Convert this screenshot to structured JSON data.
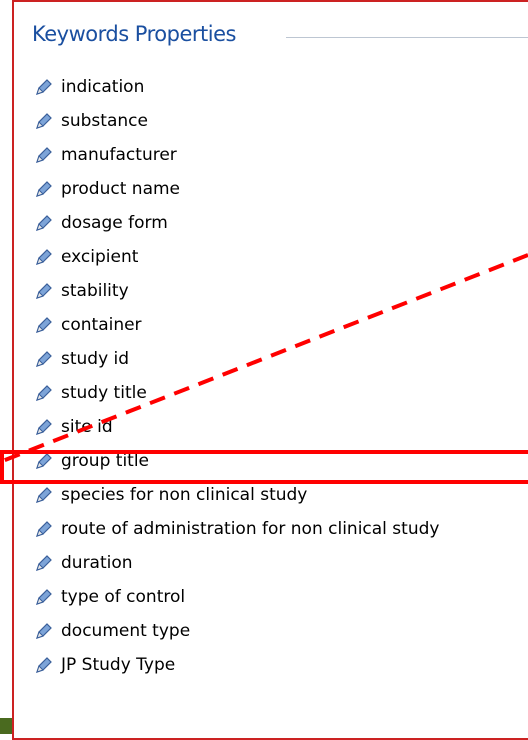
{
  "panel": {
    "title": "Keywords Properties",
    "items": [
      {
        "label": "indication"
      },
      {
        "label": "substance"
      },
      {
        "label": "manufacturer"
      },
      {
        "label": "product name"
      },
      {
        "label": "dosage form"
      },
      {
        "label": "excipient"
      },
      {
        "label": "stability"
      },
      {
        "label": "container"
      },
      {
        "label": "study id"
      },
      {
        "label": "study title"
      },
      {
        "label": "site id"
      },
      {
        "label": "group title"
      },
      {
        "label": "species for non clinical study"
      },
      {
        "label": "route of administration for non clinical study"
      },
      {
        "label": "duration"
      },
      {
        "label": "type of control"
      },
      {
        "label": "document type"
      },
      {
        "label": "JP Study Type"
      }
    ],
    "highlighted_item": "group title",
    "item_icon": "pencil-icon"
  },
  "colors": {
    "title": "#1a4fa0",
    "highlight": "#ff0000",
    "frame": "#cc2222",
    "pencil": "#3a5f9a"
  }
}
